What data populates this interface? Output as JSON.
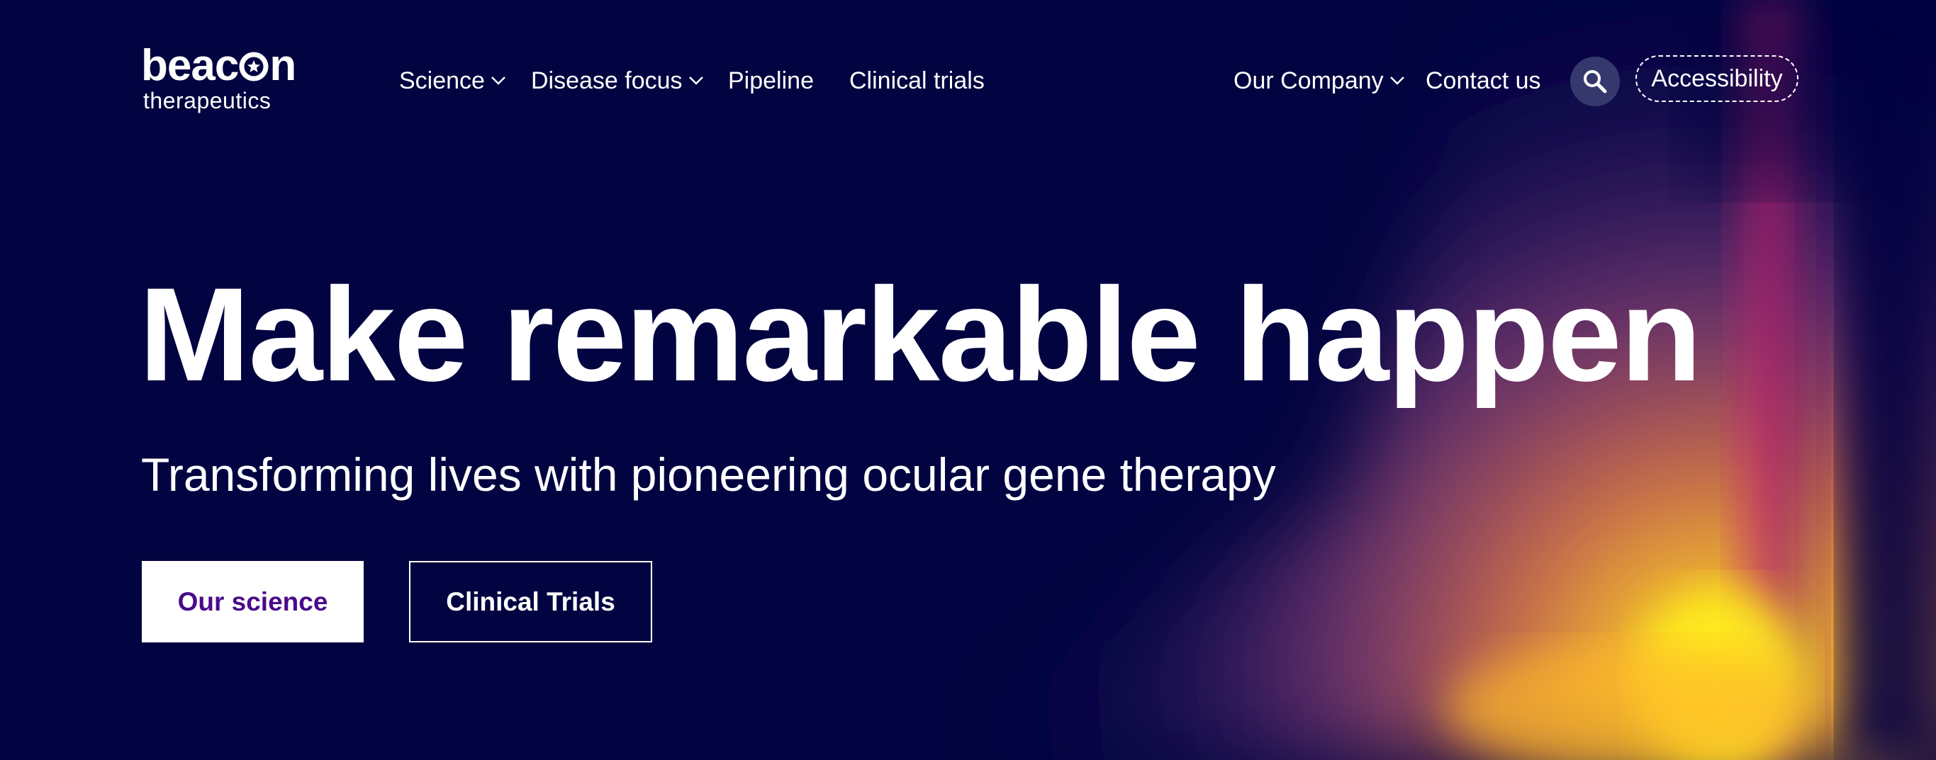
{
  "brand": {
    "name_part1": "beac",
    "name_part2": "n",
    "tagline": "therapeutics"
  },
  "nav": {
    "left": [
      {
        "label": "Science",
        "has_dropdown": true
      },
      {
        "label": "Disease focus",
        "has_dropdown": true
      },
      {
        "label": "Pipeline",
        "has_dropdown": false
      },
      {
        "label": "Clinical trials",
        "has_dropdown": false
      }
    ],
    "right": [
      {
        "label": "Our Company",
        "has_dropdown": true
      },
      {
        "label": "Contact us",
        "has_dropdown": false
      }
    ],
    "search_icon": "search-icon",
    "accessibility_label": "Accessibility"
  },
  "hero": {
    "title": "Make remarkable happen",
    "subtitle": "Transforming lives with pioneering ocular gene therapy",
    "primary_button": "Our science",
    "secondary_button": "Clinical Trials"
  },
  "colors": {
    "background": "#010440",
    "primary_button_text": "#4a0a8a",
    "search_button_bg": "#35386c",
    "glow_yellow": "#ffe81a",
    "glow_orange": "#ff8a2a",
    "glow_magenta": "#c4246e",
    "glow_purple": "#5a1a7a"
  }
}
